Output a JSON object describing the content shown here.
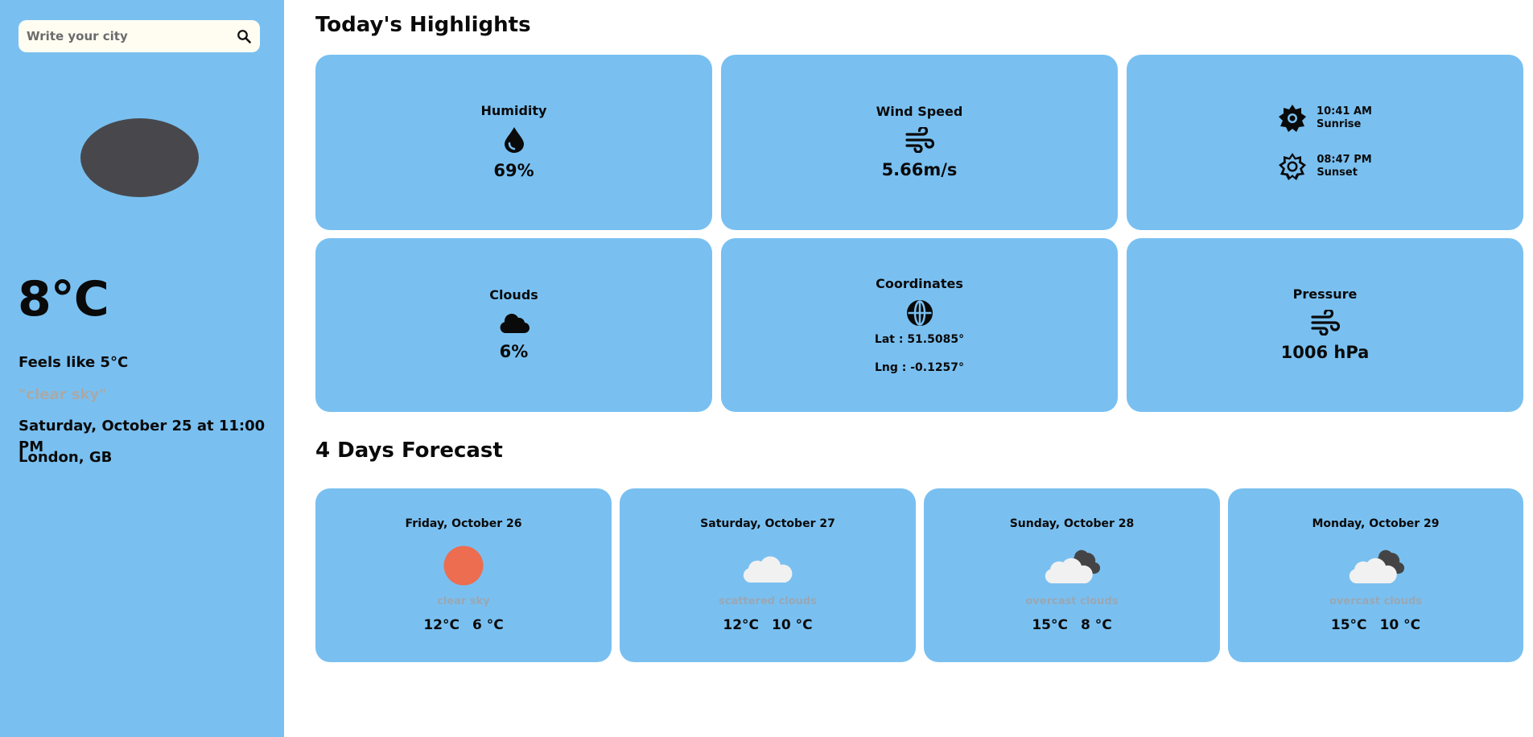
{
  "search": {
    "placeholder": "Write your city",
    "value": ""
  },
  "current": {
    "temperature": "8°C",
    "feels_like": "Feels like 5°C",
    "description": "\"clear sky\"",
    "datetime": "Saturday, October 25 at 11:00 PM",
    "location": "London, GB"
  },
  "highlights": {
    "title": "Today's Highlights",
    "humidity": {
      "label": "Humidity",
      "value": "69%"
    },
    "wind": {
      "label": "Wind Speed",
      "value": "5.66m/s"
    },
    "sun": {
      "sunrise_time": "10:41 AM",
      "sunrise_label": "Sunrise",
      "sunset_time": "08:47 PM",
      "sunset_label": "Sunset"
    },
    "clouds": {
      "label": "Clouds",
      "value": "6%"
    },
    "coordinates": {
      "label": "Coordinates",
      "lat": "Lat : 51.5085°",
      "lng": "Lng : -0.1257°"
    },
    "pressure": {
      "label": "Pressure",
      "value": "1006 hPa"
    }
  },
  "forecast": {
    "title": "4 Days Forecast",
    "days": [
      {
        "day": "Friday, October 26",
        "desc": "clear sky",
        "max": "12°C",
        "min": "6 °C",
        "icon": "sun-icon"
      },
      {
        "day": "Saturday, October 27",
        "desc": "scattered clouds",
        "max": "12°C",
        "min": "10 °C",
        "icon": "cloud-icon"
      },
      {
        "day": "Sunday, October 28",
        "desc": "overcast clouds",
        "max": "15°C",
        "min": "8 °C",
        "icon": "overcast-cloud-icon"
      },
      {
        "day": "Monday, October 29",
        "desc": "overcast clouds",
        "max": "15°C",
        "min": "10 °C",
        "icon": "overcast-cloud-icon"
      }
    ]
  },
  "colors": {
    "card": "#79c0f1",
    "search_bg": "#fffdf2",
    "sun": "#ec6d4f",
    "blob": "#48484c"
  }
}
